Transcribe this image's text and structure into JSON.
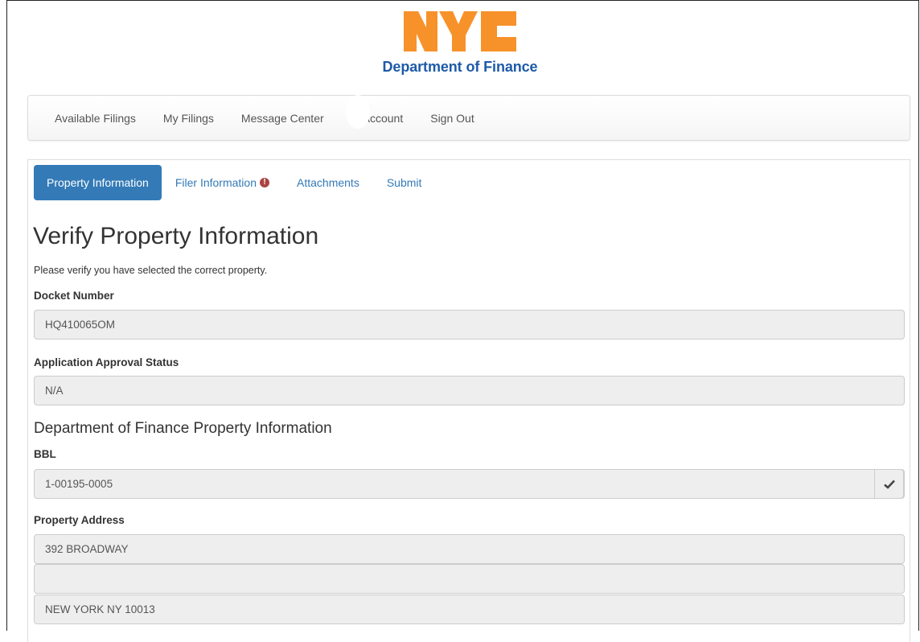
{
  "header": {
    "logo_text": "NYC",
    "department": "Department of Finance"
  },
  "nav": {
    "items": [
      "Available Filings",
      "My Filings",
      "Message Center",
      "Account",
      "Sign Out"
    ]
  },
  "tabs": [
    {
      "label": "Property Information",
      "active": true
    },
    {
      "label": "Filer Information",
      "alert": true
    },
    {
      "label": "Attachments"
    },
    {
      "label": "Submit"
    }
  ],
  "page": {
    "title": "Verify Property Information",
    "subtitle": "Please verify you have selected the correct property."
  },
  "fields": {
    "docket_label": "Docket Number",
    "docket_value": "HQ410065OM",
    "status_label": "Application Approval Status",
    "status_value": "N/A",
    "section_title": "Department of Finance Property Information",
    "bbl_label": "BBL",
    "bbl_value": "1-00195-0005",
    "address_label": "Property Address",
    "address_line1": "392 BROADWAY",
    "address_line2": "",
    "address_line3": "NEW YORK NY 10013"
  },
  "colors": {
    "brand_orange": "#f7922a",
    "brand_blue": "#1e5aa8",
    "tab_active": "#337ab7",
    "alert": "#a94442"
  },
  "icons": {
    "bbl_verified": "check-icon",
    "filer_alert": "exclamation-circle-icon"
  }
}
